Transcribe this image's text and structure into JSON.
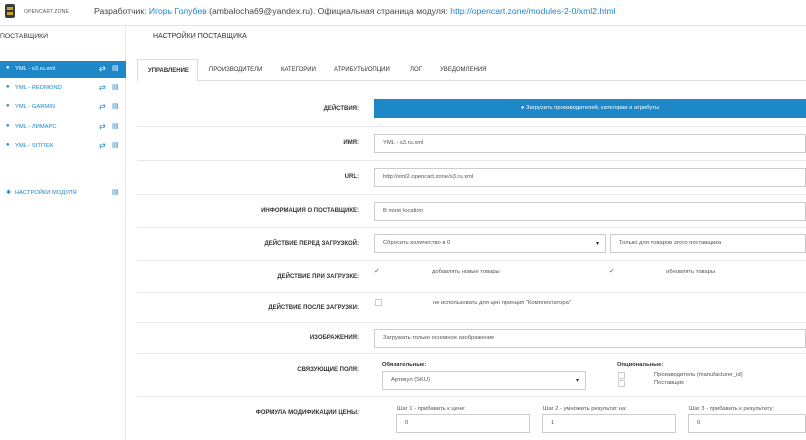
{
  "header": {
    "brand": "OPENCART.ZONE",
    "developer_prefix": "Разработчик:",
    "developer_name": "Игорь Голубев",
    "developer_email": "(ambalocha69@yandex.ru).",
    "module_page_prefix": "Официальная страница модуля:",
    "module_page_link": "http://opencart.zone/modules-2-0/xml2.html"
  },
  "sidebar": {
    "title": "ПОСТАВЩИКИ",
    "items": [
      {
        "label": "YML - s3.ru.xml"
      },
      {
        "label": "YML - REDMOND"
      },
      {
        "label": "YML - GARMIN"
      },
      {
        "label": "YML - ЛИМАРС"
      },
      {
        "label": "YML - SITITEK"
      }
    ],
    "settings_label": "НАСТРОЙКИ МОДУЛЯ"
  },
  "main": {
    "title": "НАСТРОЙКИ ПОСТАВЩИКА",
    "tabs": [
      "УПРАВЛЕНИЕ",
      "ПРОИЗВОДИТЕЛИ",
      "КАТЕГОРИИ",
      "АТРИБУТЫ/ОПЦИИ",
      "ЛОГ",
      "УВЕДОМЛЕНИЯ"
    ]
  },
  "form": {
    "actions_label": "ДЕЙСТВИЯ:",
    "load_button": "Загрузить производителей, категории и атрибуты",
    "name_label": "ИМЯ:",
    "name_value": "YML - s3.ru.xml",
    "url_label": "URL:",
    "url_value": "http://xml2.opencart.zone/s3.ru.xml",
    "info_label": "ИНФОРМАЦИЯ О ПОСТАВЩИКЕ:",
    "info_value": "В поле location",
    "before_label": "ДЕЙСТВИЕ ПЕРЕД ЗАГРУЗКОЙ:",
    "before_select1": "Сбросить количество в 0",
    "before_select2": "Только для товаров этого поставщика",
    "during_label": "ДЕЙСТВИЕ ПРИ ЗАГРУЗКЕ:",
    "during_opt1": "добавлять новые товары",
    "during_opt2": "обновлять товары",
    "after_label": "ДЕЙСТВИЕ ПОСЛЕ ЗАГРУЗКИ:",
    "after_opt": "не использовать для цен принцип \"Комплектатора\"",
    "images_label": "ИЗОБРАЖЕНИЯ:",
    "images_value": "Загружать только основное изображение",
    "link_label": "СВЯЗУЮЩИЕ ПОЛЯ:",
    "required_title": "Обязательные:",
    "required_value": "Артикул (SKU)",
    "optional_title": "Опциональные:",
    "optional_1": "Производитель (manufacturer_id)",
    "optional_2": "Поставщик",
    "formula_label": "ФОРМУЛА МОДИФИКАЦИИ ЦЕНЫ:",
    "step1_label": "Шаг 1 - прибавить к цене:",
    "step1_value": "0",
    "step2_label": "Шаг 2 - умножить результат на:",
    "step2_value": "1",
    "step3_label": "Шаг 3 - прибавить к результату:",
    "step3_value": "0"
  },
  "colors": {
    "accent": "#1e87c7"
  }
}
